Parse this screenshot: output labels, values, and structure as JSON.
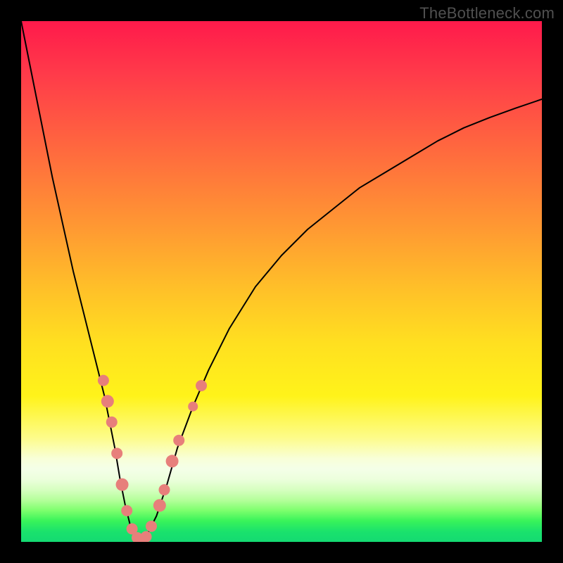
{
  "attribution": "TheBottleneck.com",
  "chart_data": {
    "type": "line",
    "title": "",
    "xlabel": "",
    "ylabel": "",
    "xlim": [
      0,
      100
    ],
    "ylim": [
      0,
      100
    ],
    "series": [
      {
        "name": "bottleneck-curve",
        "x": [
          0,
          2,
          4,
          6,
          8,
          10,
          12,
          14,
          16,
          18,
          19,
          20,
          21,
          22,
          23,
          24,
          26,
          28,
          30,
          33,
          36,
          40,
          45,
          50,
          55,
          60,
          65,
          70,
          75,
          80,
          85,
          90,
          95,
          100
        ],
        "y": [
          100,
          90,
          80,
          70,
          61,
          52,
          44,
          36,
          28,
          18,
          12,
          7,
          3,
          1,
          0.3,
          1,
          5,
          11,
          18,
          26,
          33,
          41,
          49,
          55,
          60,
          64,
          68,
          71,
          74,
          77,
          79.5,
          81.5,
          83.3,
          85
        ],
        "stroke": "#000000",
        "stroke_width": 2
      }
    ],
    "markers": [
      {
        "x": 15.8,
        "y": 31,
        "r": 8
      },
      {
        "x": 16.6,
        "y": 27,
        "r": 9
      },
      {
        "x": 17.4,
        "y": 23,
        "r": 8
      },
      {
        "x": 18.4,
        "y": 17,
        "r": 8
      },
      {
        "x": 19.4,
        "y": 11,
        "r": 9
      },
      {
        "x": 20.3,
        "y": 6,
        "r": 8
      },
      {
        "x": 21.3,
        "y": 2.5,
        "r": 8
      },
      {
        "x": 22.3,
        "y": 0.8,
        "r": 8
      },
      {
        "x": 23.1,
        "y": 0.3,
        "r": 9
      },
      {
        "x": 24.0,
        "y": 1.0,
        "r": 8
      },
      {
        "x": 25.0,
        "y": 3.0,
        "r": 8
      },
      {
        "x": 26.6,
        "y": 7.0,
        "r": 9
      },
      {
        "x": 27.5,
        "y": 10.0,
        "r": 8
      },
      {
        "x": 29.0,
        "y": 15.5,
        "r": 9
      },
      {
        "x": 30.3,
        "y": 19.5,
        "r": 8
      },
      {
        "x": 33.0,
        "y": 26.0,
        "r": 7
      },
      {
        "x": 34.6,
        "y": 30.0,
        "r": 8
      }
    ],
    "marker_style": {
      "fill": "#e77f7b",
      "stroke": "none"
    },
    "bands": [
      {
        "name": "pale-yellow",
        "from_y": 78,
        "to_y": 86,
        "color": "#fdfeaa"
      },
      {
        "name": "green",
        "from_y": 95,
        "to_y": 100,
        "color": "#1de070"
      }
    ]
  }
}
